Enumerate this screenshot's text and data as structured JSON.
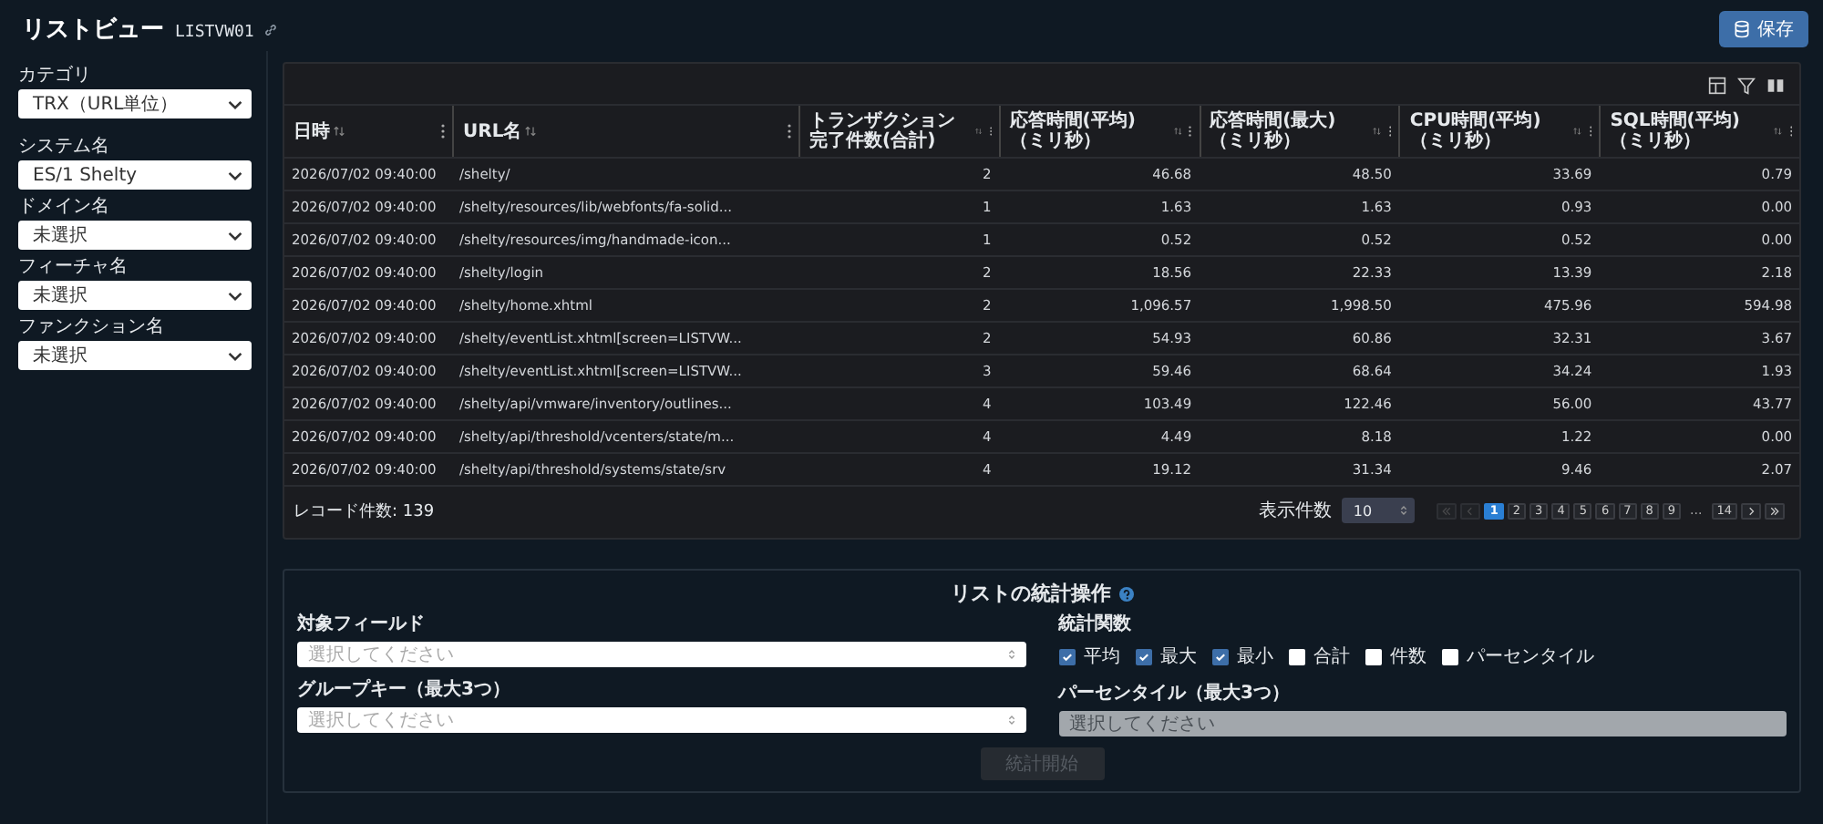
{
  "header": {
    "title": "リストビュー",
    "code": "LISTVW01",
    "save_button": "保存"
  },
  "sidebar": {
    "filters": [
      {
        "label": "カテゴリ",
        "value": "TRX（URL単位）"
      },
      {
        "label": "システム名",
        "value": "ES/1 Shelty"
      },
      {
        "label": "ドメイン名",
        "value": "未選択"
      },
      {
        "label": "フィーチャ名",
        "value": "未選択"
      },
      {
        "label": "ファンクション名",
        "value": "未選択"
      }
    ]
  },
  "table": {
    "columns": [
      "日時",
      "URL名",
      "トランザクション完了件数(合計)",
      "応答時間(平均)（ミリ秒）",
      "応答時間(最大)（ミリ秒）",
      "CPU時間(平均)（ミリ秒）",
      "SQL時間(平均)（ミリ秒）"
    ],
    "rows": [
      [
        "2026/07/02 09:40:00",
        "/shelty/",
        "2",
        "46.68",
        "48.50",
        "33.69",
        "0.79"
      ],
      [
        "2026/07/02 09:40:00",
        "/shelty/resources/lib/webfonts/fa-solid...",
        "1",
        "1.63",
        "1.63",
        "0.93",
        "0.00"
      ],
      [
        "2026/07/02 09:40:00",
        "/shelty/resources/img/handmade-icon...",
        "1",
        "0.52",
        "0.52",
        "0.52",
        "0.00"
      ],
      [
        "2026/07/02 09:40:00",
        "/shelty/login",
        "2",
        "18.56",
        "22.33",
        "13.39",
        "2.18"
      ],
      [
        "2026/07/02 09:40:00",
        "/shelty/home.xhtml",
        "2",
        "1,096.57",
        "1,998.50",
        "475.96",
        "594.98"
      ],
      [
        "2026/07/02 09:40:00",
        "/shelty/eventList.xhtml[screen=LISTVW...",
        "2",
        "54.93",
        "60.86",
        "32.31",
        "3.67"
      ],
      [
        "2026/07/02 09:40:00",
        "/shelty/eventList.xhtml[screen=LISTVW...",
        "3",
        "59.46",
        "68.64",
        "34.24",
        "1.93"
      ],
      [
        "2026/07/02 09:40:00",
        "/shelty/api/vmware/inventory/outlines...",
        "4",
        "103.49",
        "122.46",
        "56.00",
        "43.77"
      ],
      [
        "2026/07/02 09:40:00",
        "/shelty/api/threshold/vcenters/state/m...",
        "4",
        "4.49",
        "8.18",
        "1.22",
        "0.00"
      ],
      [
        "2026/07/02 09:40:00",
        "/shelty/api/threshold/systems/state/srv",
        "4",
        "19.12",
        "31.34",
        "9.46",
        "2.07"
      ]
    ],
    "record_count": "レコード件数: 139",
    "page_size_label": "表示件数",
    "page_size": "10",
    "pages": [
      {
        "kind": "page",
        "label": "1",
        "selected": true
      },
      {
        "kind": "page",
        "label": "2",
        "selected": false
      },
      {
        "kind": "page",
        "label": "3",
        "selected": false
      },
      {
        "kind": "page",
        "label": "4",
        "selected": false
      },
      {
        "kind": "page",
        "label": "5",
        "selected": false
      },
      {
        "kind": "page",
        "label": "6",
        "selected": false
      },
      {
        "kind": "page",
        "label": "7",
        "selected": false
      },
      {
        "kind": "page",
        "label": "8",
        "selected": false
      },
      {
        "kind": "page",
        "label": "9",
        "selected": false
      },
      {
        "kind": "ellipsis",
        "label": "..."
      },
      {
        "kind": "page",
        "label": "14",
        "selected": false
      }
    ]
  },
  "stats": {
    "title": "リストの統計操作",
    "target_field": {
      "label": "対象フィールド",
      "placeholder": "選択してください"
    },
    "group_key": {
      "label": "グループキー（最大3つ）",
      "placeholder": "選択してください"
    },
    "functions_label": "統計関数",
    "functions": [
      {
        "label": "平均",
        "checked": true
      },
      {
        "label": "最大",
        "checked": true
      },
      {
        "label": "最小",
        "checked": true
      },
      {
        "label": "合計",
        "checked": false
      },
      {
        "label": "件数",
        "checked": false
      },
      {
        "label": "パーセンタイル",
        "checked": false
      }
    ],
    "percentile": {
      "label": "パーセンタイル（最大3つ）",
      "placeholder": "選択してください",
      "disabled": true
    },
    "submit": {
      "label": "統計開始",
      "disabled": true
    }
  }
}
